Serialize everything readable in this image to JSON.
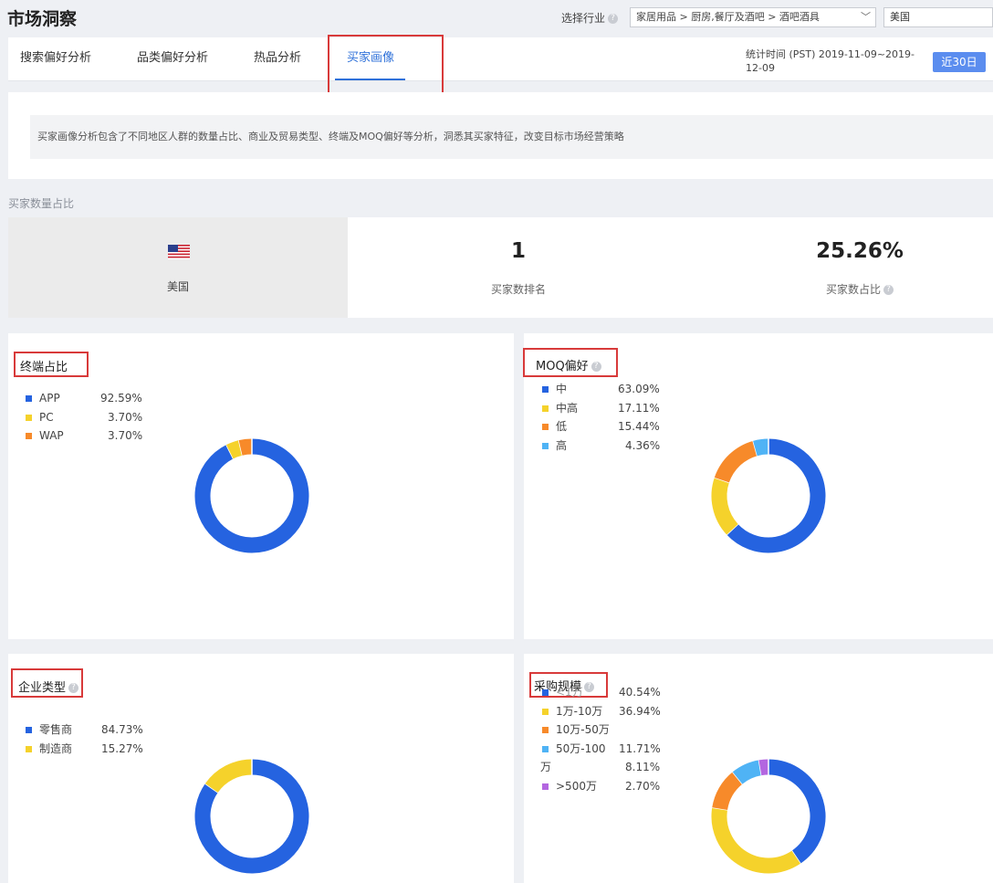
{
  "header": {
    "title": "市场洞察",
    "industry_label": "选择行业",
    "industry_value": "家居用品 > 厨房,餐厅及酒吧 > 酒吧酒具",
    "country_value": "美国"
  },
  "tabs": [
    {
      "label": "搜索偏好分析"
    },
    {
      "label": "品类偏好分析"
    },
    {
      "label": "热品分析"
    },
    {
      "label": "买家画像"
    }
  ],
  "stat_time_line1": "统计时间 (PST) 2019-11-09~2019-",
  "stat_time_line2": "12-09",
  "range_button": "近30日",
  "description": "买家画像分析包含了不同地区人群的数量占比、商业及贸易类型、终端及MOQ偏好等分析，洞悉其买家特征，改变目标市场经营策略",
  "buyer_section_label": "买家数量占比",
  "kpi": {
    "country": "美国",
    "rank_value": "1",
    "rank_label": "买家数排名",
    "share_value": "25.26%",
    "share_label": "买家数占比"
  },
  "colors": {
    "blue": "#2563e0",
    "yellow": "#f5d22b",
    "orange": "#f78a2a",
    "lightblue": "#4fb3f5",
    "purple": "#b366e0",
    "accent": "#2f71d9",
    "highlight_box": "#d83a3a"
  },
  "icons": {
    "help": "question-circle-icon",
    "dropdown": "chevron-down-icon",
    "flag": "us-flag-icon"
  },
  "chart_data": [
    {
      "type": "pie",
      "title": "终端占比",
      "categories": [
        "APP",
        "PC",
        "WAP"
      ],
      "values": [
        92.59,
        3.7,
        3.7
      ],
      "labels": [
        "92.59%",
        "3.70%",
        "3.70%"
      ],
      "colors": [
        "#2563e0",
        "#f5d22b",
        "#f78a2a"
      ]
    },
    {
      "type": "pie",
      "title": "MOQ偏好",
      "categories": [
        "中",
        "中高",
        "低",
        "高"
      ],
      "values": [
        63.09,
        17.11,
        15.44,
        4.36
      ],
      "labels": [
        "63.09%",
        "17.11%",
        "15.44%",
        "4.36%"
      ],
      "colors": [
        "#2563e0",
        "#f5d22b",
        "#f78a2a",
        "#4fb3f5"
      ]
    },
    {
      "type": "pie",
      "title": "企业类型",
      "categories": [
        "零售商",
        "制造商"
      ],
      "values": [
        84.73,
        15.27
      ],
      "labels": [
        "84.73%",
        "15.27%"
      ],
      "colors": [
        "#2563e0",
        "#f5d22b"
      ]
    },
    {
      "type": "pie",
      "title": "采购规模",
      "categories": [
        "<1万",
        "1万-10万",
        "10万-50万",
        "50万-100万",
        ">500万"
      ],
      "values": [
        40.54,
        36.94,
        11.71,
        8.11,
        2.7
      ],
      "labels": [
        "40.54%",
        "36.94%",
        "11.71%",
        "8.11%",
        "2.70%"
      ],
      "colors": [
        "#2563e0",
        "#f5d22b",
        "#f78a2a",
        "#4fb3f5",
        "#b366e0"
      ]
    }
  ]
}
